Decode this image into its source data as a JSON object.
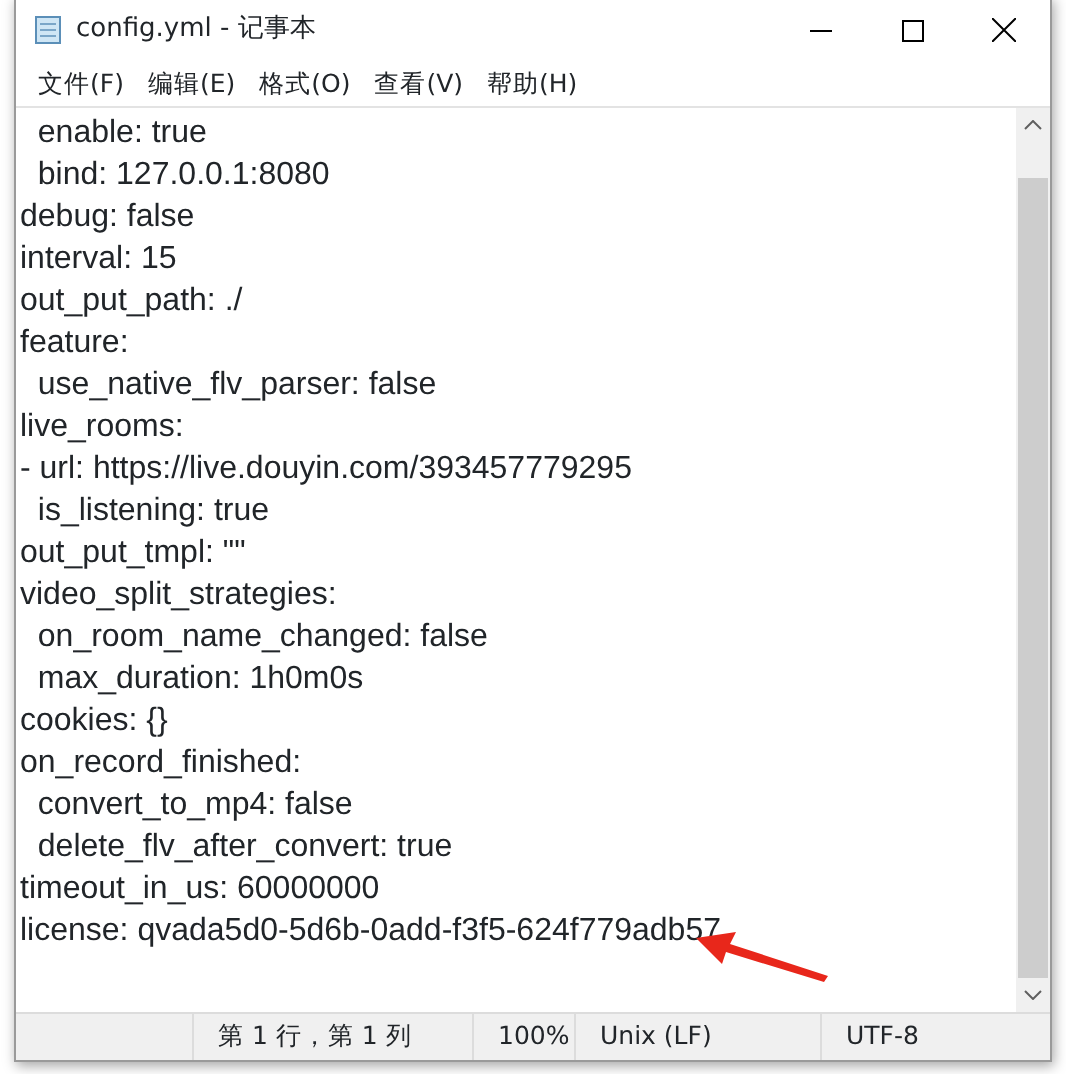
{
  "window": {
    "title": "config.yml - 记事本"
  },
  "menu": [
    {
      "label": "文件(F)"
    },
    {
      "label": "编辑(E)"
    },
    {
      "label": "格式(O)"
    },
    {
      "label": "查看(V)"
    },
    {
      "label": "帮助(H)"
    }
  ],
  "editor": {
    "lines": [
      "  enable: true",
      "  bind: 127.0.0.1:8080",
      "debug: false",
      "interval: 15",
      "out_put_path: ./",
      "feature:",
      "  use_native_flv_parser: false",
      "live_rooms:",
      "- url: https://live.douyin.com/393457779295",
      "  is_listening: true",
      "out_put_tmpl: \"\"",
      "video_split_strategies:",
      "  on_room_name_changed: false",
      "  max_duration: 1h0m0s",
      "cookies: {}",
      "on_record_finished:",
      "  convert_to_mp4: false",
      "  delete_flv_after_convert: true",
      "timeout_in_us: 60000000",
      "license: qvada5d0-5d6b-0add-f3f5-624f779adb57"
    ]
  },
  "status_bar": {
    "position": "第 1 行，第 1 列",
    "zoom": "100%",
    "line_ending": "Unix (LF)",
    "encoding": "UTF-8"
  }
}
